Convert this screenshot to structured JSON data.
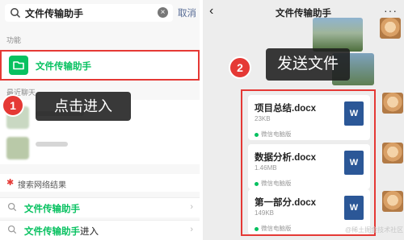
{
  "search": {
    "query": "文件传输助手",
    "cancel_label": "取消"
  },
  "left": {
    "section_function": "功能",
    "function_item": "文件传输助手",
    "section_recent": "最近聊天",
    "callout": "点击进入",
    "step": "1",
    "net_label": "搜索网络结果",
    "suggestions": [
      {
        "highlight": "文件传输助手",
        "rest": ""
      },
      {
        "highlight": "文件传输助手",
        "rest": "进入"
      }
    ]
  },
  "chat": {
    "back": "‹",
    "title": "文件传输助手",
    "more": "···",
    "step": "2",
    "callout": "发送文件",
    "files": [
      {
        "name": "项目总结.docx",
        "size": "23KB",
        "source": "微信电脑版",
        "icon": "W"
      },
      {
        "name": "数据分析.docx",
        "size": "1.46MB",
        "source": "微信电脑版",
        "icon": "W"
      },
      {
        "name": "第一部分.docx",
        "size": "149KB",
        "source": "微信电脑版",
        "icon": "W"
      }
    ],
    "watermark": "@稀土掘金技术社区"
  },
  "colors": {
    "accent": "#07c160",
    "highlight_border": "#e53935",
    "link": "#576b95",
    "word": "#2b5797"
  }
}
